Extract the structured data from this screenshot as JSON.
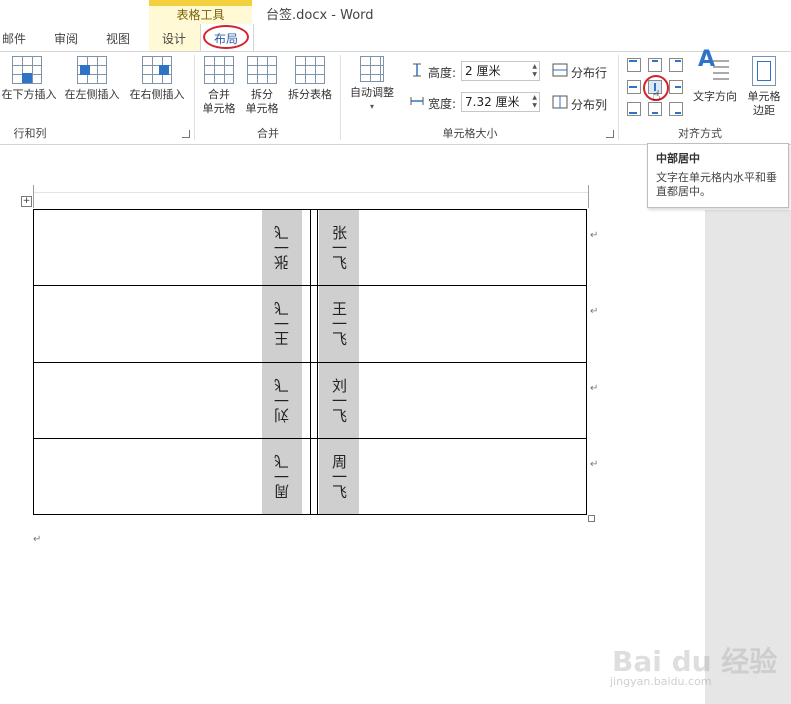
{
  "title_bar": {
    "contextual_label": "表格工具",
    "document_title": "台签.docx - Word"
  },
  "tabs": [
    "邮件",
    "审阅",
    "视图",
    "设计",
    "布局"
  ],
  "ribbon": {
    "rows_cols": {
      "group_label": "行和列",
      "buttons": [
        "在下方插入",
        "在左侧插入",
        "在右侧插入"
      ]
    },
    "merge": {
      "group_label": "合并",
      "merge_cells": [
        "合并",
        "单元格"
      ],
      "split_cells": [
        "拆分",
        "单元格"
      ],
      "split_table": "拆分表格"
    },
    "cell_size": {
      "group_label": "单元格大小",
      "autofit": "自动调整",
      "height_label": "高度:",
      "height_value": "2 厘米",
      "width_label": "宽度:",
      "width_value": "7.32 厘米",
      "distribute_rows": "分布行",
      "distribute_cols": "分布列"
    },
    "alignment": {
      "group_label": "对齐方式",
      "text_direction": "文字方向",
      "cell_margins": [
        "单元格",
        "边距"
      ]
    }
  },
  "tooltip": {
    "title": "中部居中",
    "description": "文字在单元格内水平和垂直都居中。"
  },
  "table_rows": [
    {
      "left": "张一飞",
      "right": "张一飞"
    },
    {
      "left": "王一飞",
      "right": "王一飞"
    },
    {
      "left": "刘一飞",
      "right": "刘一飞"
    },
    {
      "left": "周一飞",
      "right": "周一飞"
    }
  ],
  "marks": {
    "para": "↵"
  },
  "watermark": {
    "logo": "Bai du 经验",
    "url": "jingyan.baidu.com"
  },
  "colors": {
    "accent": "#2f73c6",
    "tools_band": "#f3d13e",
    "highlight_circle": "#d2232a",
    "cell_shade": "#cfcfcf"
  }
}
